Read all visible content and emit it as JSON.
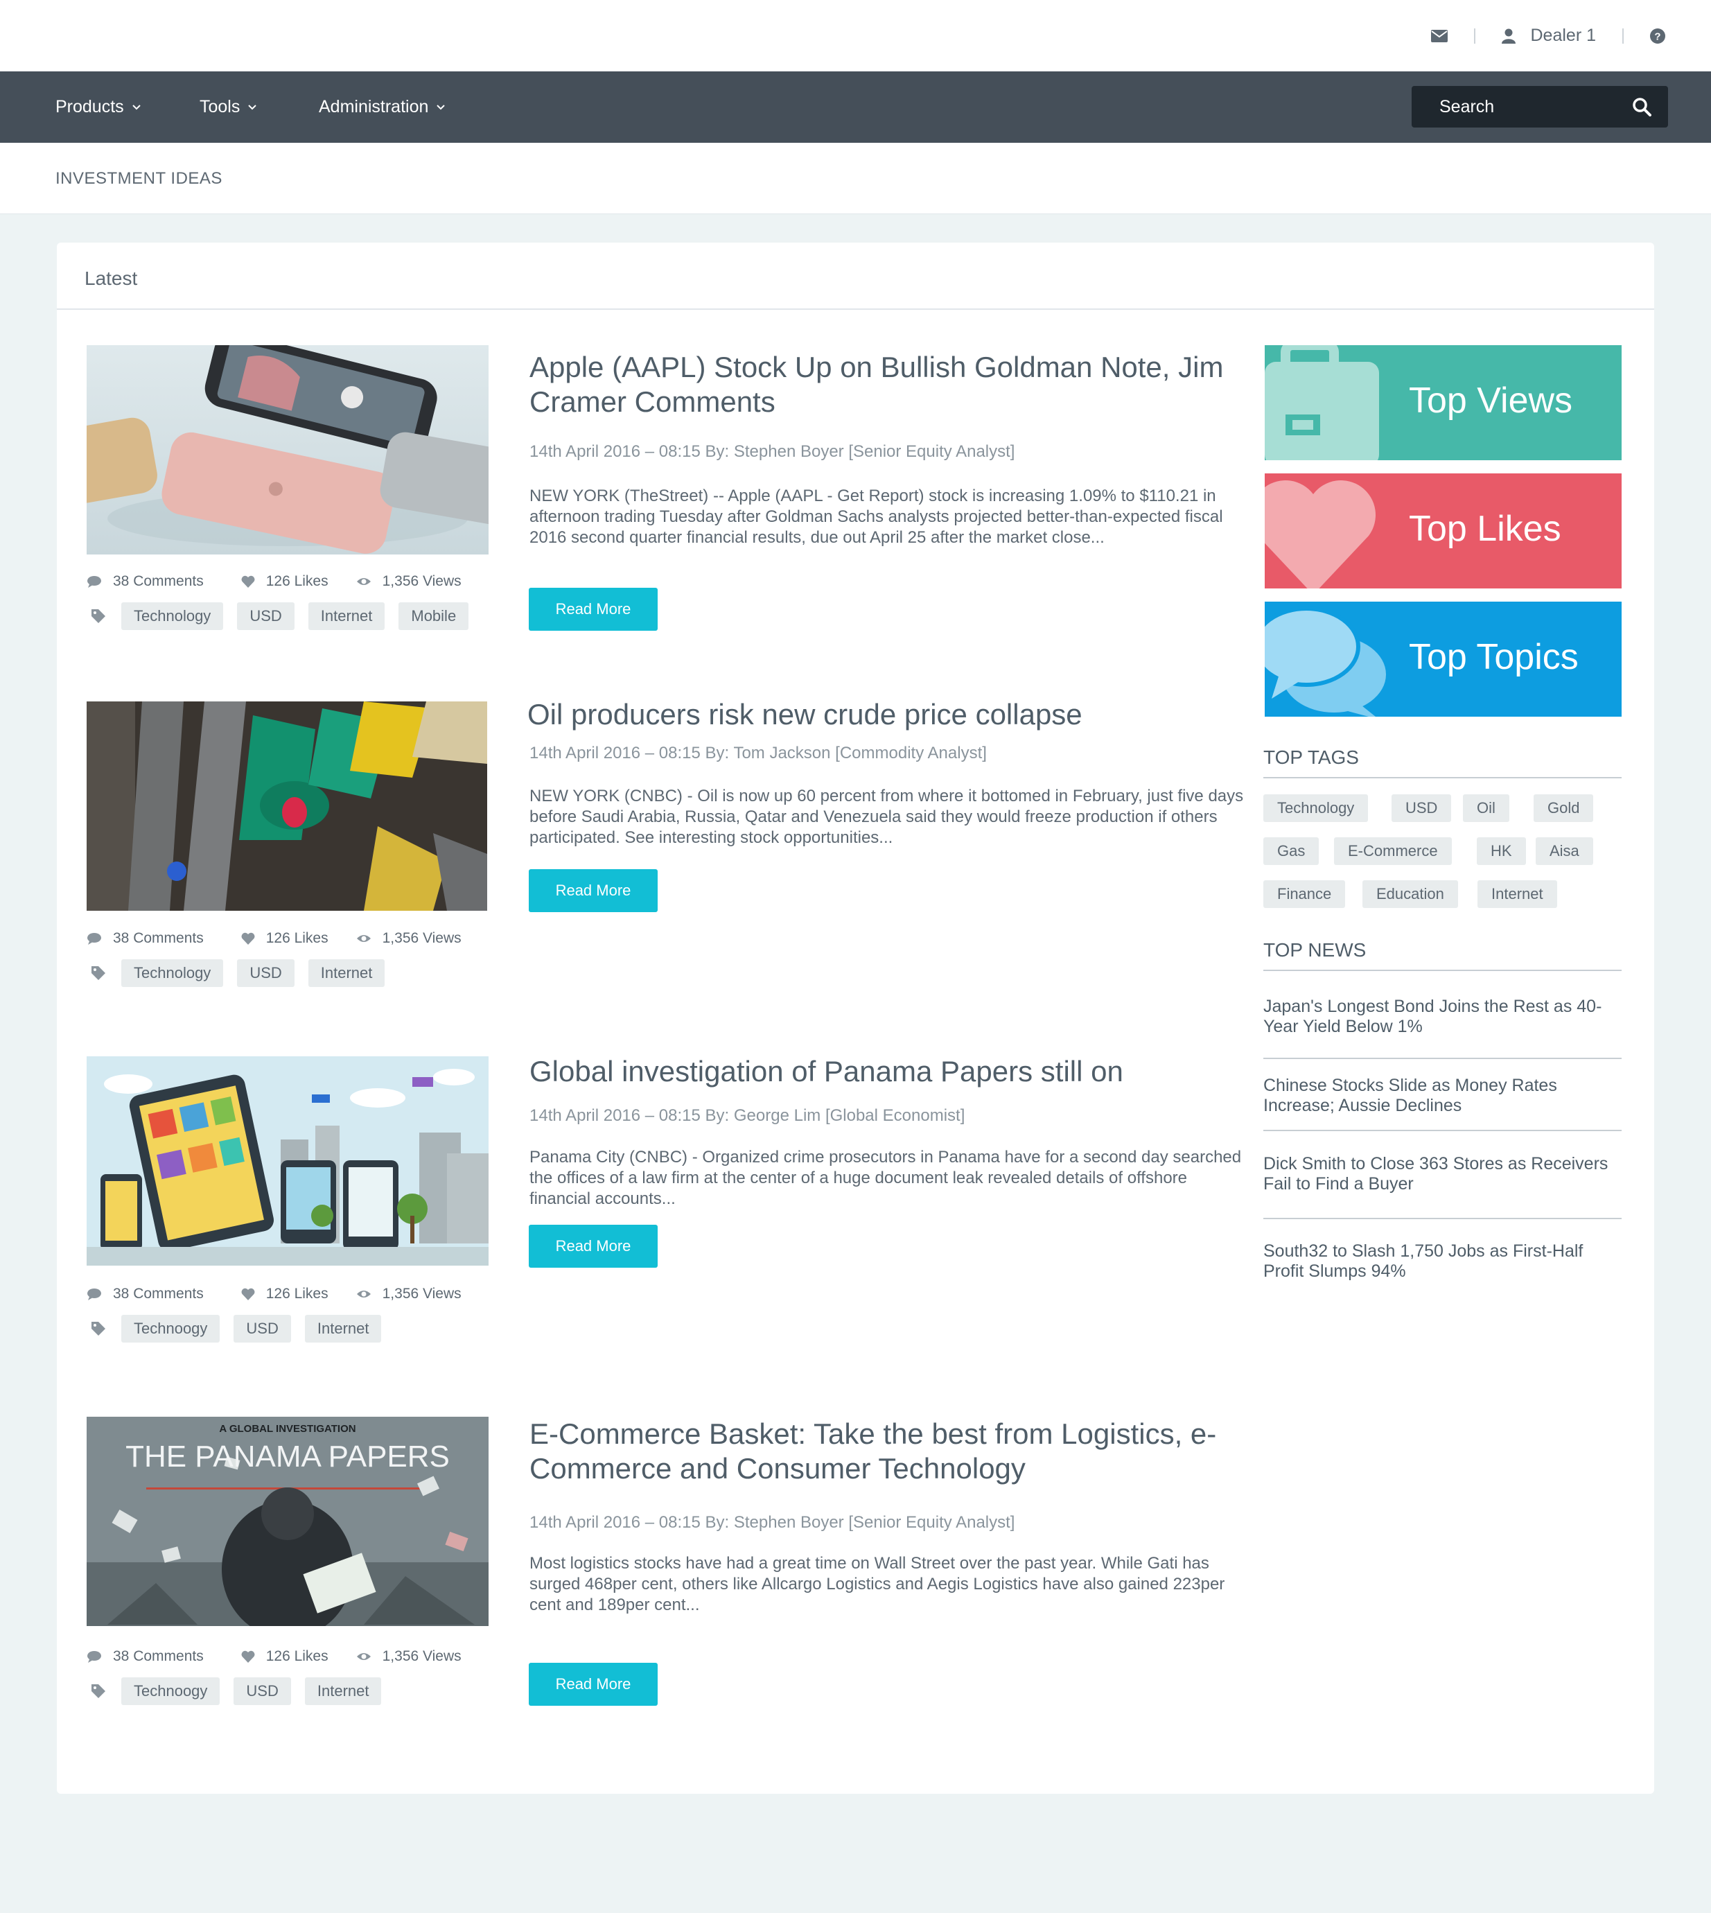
{
  "topbar": {
    "user": "Dealer 1"
  },
  "nav": {
    "menus": [
      "Products",
      "Tools",
      "Administration"
    ],
    "search_placeholder": "Search"
  },
  "breadcrumb": "INVESTMENT IDEAS",
  "section_title": "Latest",
  "articles": [
    {
      "title": "Apple (AAPL) Stock Up on Bullish Goldman Note, Jim Cramer Comments",
      "date": "14th April 2016 – 08:15 By: Stephen Boyer [Senior Equity Analyst]",
      "summary": "NEW YORK (TheStreet) -- Apple (AAPL - Get Report) stock is increasing 1.09% to $110.21 in afternoon trading Tuesday after Goldman Sachs analysts projected better-than-expected fiscal 2016 second quarter financial results, due out  April 25 after the market close...",
      "comments": "38 Comments",
      "likes": "126 Likes",
      "views": "1,356 Views",
      "tags": [
        "Technology",
        "USD",
        "Internet",
        "Mobile"
      ],
      "read_more": "Read More"
    },
    {
      "title": "Oil producers risk new crude price collapse",
      "date": "14th April 2016 – 08:15 By: Tom Jackson [Commodity Analyst]",
      "summary": "NEW YORK (CNBC) - Oil is now up 60 percent from where it bottomed in February, just five days before Saudi Arabia, Russia, Qatar and Venezuela said they would freeze production if others participated. See interesting stock opportunities...",
      "comments": "38 Comments",
      "likes": "126 Likes",
      "views": "1,356 Views",
      "tags": [
        "Technology",
        "USD",
        "Internet"
      ],
      "read_more": "Read More"
    },
    {
      "title": "Global investigation of Panama Papers still on",
      "date": "14th April 2016 – 08:15 By: George Lim [Global Economist]",
      "summary": "Panama City (CNBC) - Organized crime prosecutors in Panama have for a second day searched the offices of a law firm at the center of a huge document leak revealed details of offshore financial accounts...",
      "comments": "38 Comments",
      "likes": "126 Likes",
      "views": "1,356 Views",
      "tags": [
        "Technoogy",
        "USD",
        "Internet"
      ],
      "read_more": "Read More"
    },
    {
      "title": "E-Commerce Basket: Take the best from Logistics, e-Commerce and Consumer Technology",
      "date": "14th April 2016 – 08:15 By: Stephen Boyer [Senior Equity Analyst]",
      "summary": "Most logistics stocks have had a great time on Wall Street over the past year. While Gati has surged 468per cent, others like Allcargo Logistics and Aegis Logistics have also gained 223per cent and 189per cent...",
      "comments": "38 Comments",
      "likes": "126 Likes",
      "views": "1,356 Views",
      "tags": [
        "Technoogy",
        "USD",
        "Internet"
      ],
      "read_more": "Read More"
    }
  ],
  "thumb4": {
    "kicker": "A GLOBAL INVESTIGATION",
    "headline": "THE PANAMA PAPERS"
  },
  "sidebar": {
    "tiles": [
      {
        "label": "Top Views",
        "color": "#46b8a9",
        "icon": "briefcase-icon"
      },
      {
        "label": "Top Likes",
        "color": "#e85a68",
        "icon": "heart-icon"
      },
      {
        "label": "Top Topics",
        "color": "#0d9de0",
        "icon": "chat-bubbles-icon"
      }
    ],
    "top_tags_title": "TOP TAGS",
    "top_tags": [
      "Technology",
      "USD",
      "Oil",
      "Gold",
      "Gas",
      "E-Commerce",
      "HK",
      "Aisa",
      "Finance",
      "Education",
      "Internet"
    ],
    "top_news_title": "TOP NEWS",
    "top_news": [
      "Japan's Longest Bond Joins the Rest as 40-Year Yield Below 1%",
      "Chinese Stocks Slide as Money Rates Increase; Aussie Declines",
      "Dick Smith to Close 363 Stores as Receivers Fail to Find a Buyer",
      "South32 to Slash 1,750 Jobs as First-Half Profit Slumps 94%"
    ]
  },
  "colors": {
    "nav": "#454f59",
    "accent": "#12bed5",
    "page_bg": "#edf3f4"
  }
}
